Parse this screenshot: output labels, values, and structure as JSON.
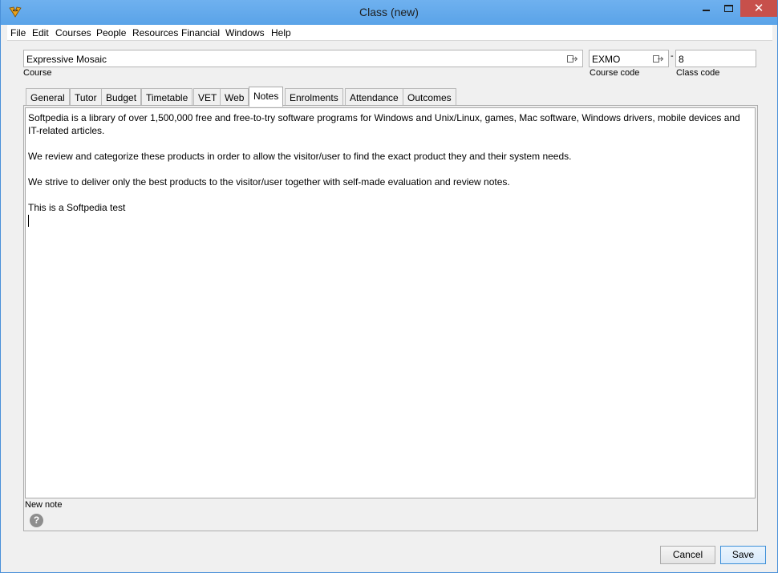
{
  "window": {
    "title": "Class (new)",
    "close_glyph": "✕",
    "icon": "app-logo-icon"
  },
  "menu": [
    "File",
    "Edit",
    "Courses",
    "People",
    "Resources",
    "Financial",
    "Windows",
    "Help"
  ],
  "course": {
    "value": "Expressive Mosaic",
    "label": "Course"
  },
  "course_code": {
    "value": "EXMO",
    "label": "Course code"
  },
  "separator": "-",
  "class_code": {
    "value": "8",
    "label": "Class code"
  },
  "tabs": [
    "General",
    "Tutor",
    "Budget",
    "Timetable",
    "VET",
    "Web",
    "Notes",
    "Enrolments",
    "Attendance",
    "Outcomes"
  ],
  "active_tab": "Notes",
  "notes": {
    "paragraphs": [
      "Softpedia is a library of over 1,500,000 free and free-to-try software programs for Windows and Unix/Linux, games, Mac software, Windows drivers, mobile devices and IT-related articles.",
      "We review and categorize these products in order to allow the visitor/user to find the exact product they and their system needs.",
      "We strive to deliver only the best products to the visitor/user together with self-made evaluation and review notes.",
      "This is a Softpedia test"
    ],
    "label": "New note"
  },
  "help_glyph": "?",
  "buttons": {
    "cancel": "Cancel",
    "save": "Save"
  },
  "colors": {
    "titlebar": "#5aa3e8",
    "close": "#c7504b",
    "accent": "#3c8fd8"
  }
}
